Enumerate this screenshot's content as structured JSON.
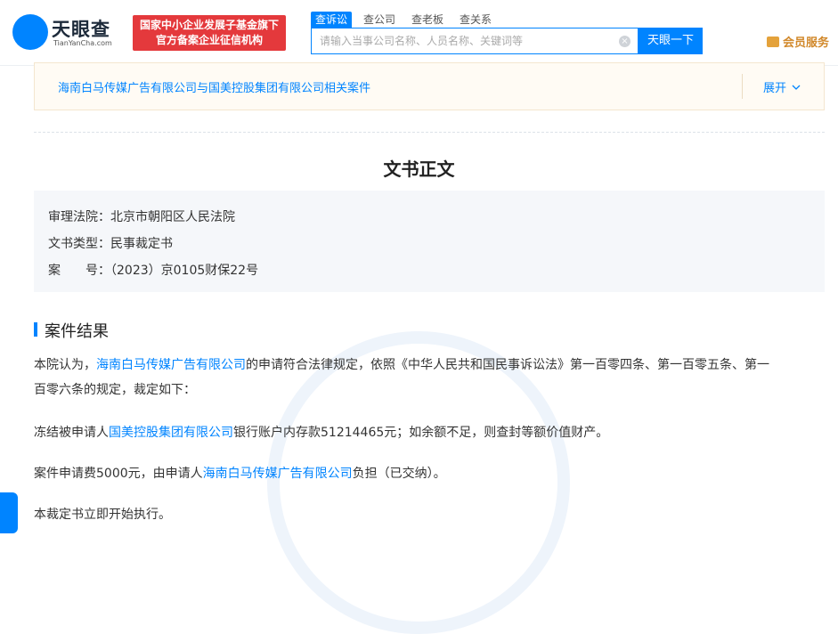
{
  "header": {
    "brand_name": "天眼查",
    "brand_sub": "TianYanCha.com",
    "promo_line1": "国家中小企业发展子基金旗下",
    "promo_line2": "官方备案企业征信机构",
    "tabs": [
      {
        "label": "查诉讼",
        "active": true
      },
      {
        "label": "查公司",
        "active": false
      },
      {
        "label": "查老板",
        "active": false
      },
      {
        "label": "查关系",
        "active": false
      }
    ],
    "search_placeholder": "请输入当事公司名称、人员名称、关键词等",
    "search_button": "天眼一下",
    "vip_label": "会员服务"
  },
  "related": {
    "text": "海南白马传媒广告有限公司与国美控股集团有限公司相关案件",
    "expand_label": "展开"
  },
  "doc": {
    "title": "文书正文",
    "court_label": "审理法院：",
    "court_value": "北京市朝阳区人民法院",
    "type_label": "文书类型：",
    "type_value": "民事裁定书",
    "case_label": "案　　号：",
    "case_value": "（2023）京0105财保22号"
  },
  "result": {
    "section_title": "案件结果",
    "p1_a": "本院认为，",
    "p1_link": "海南白马传媒广告有限公司",
    "p1_b": "的申请符合法律规定，依照《中华人民共和国民事诉讼法》第一百零四条、第一百零五条、第一",
    "p1_c": "百零六条的规定，裁定如下：",
    "p2_a": "冻结被申请人",
    "p2_link": "国美控股集团有限公司",
    "p2_b": "银行账户内存款51214465元；如余额不足，则查封等额价值财产。",
    "p3_a": "案件申请费5000元，由申请人",
    "p3_link": "海南白马传媒广告有限公司",
    "p3_b": "负担（已交纳）。",
    "p4": "本裁定书立即开始执行。"
  },
  "colors": {
    "accent": "#0084ff",
    "promo": "#e4393c",
    "vip": "#d1882a"
  },
  "icons": [
    "tianyancha-logo-icon",
    "clear-icon",
    "crown-icon",
    "chevron-down-icon"
  ]
}
